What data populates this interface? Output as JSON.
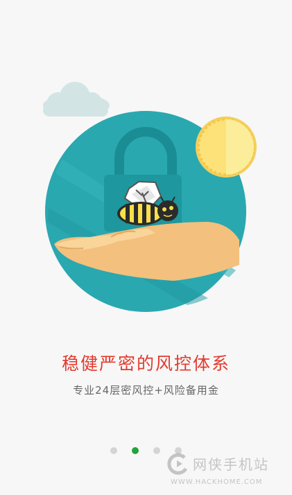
{
  "slide": {
    "headline": "稳健严密的风控体系",
    "subtitle": "专业24层密风控+风险备用金"
  },
  "pager": {
    "total": 4,
    "active_index": 1
  },
  "watermark": {
    "name": "网侠手机站",
    "url": "WWW.HACKHOME.COM"
  },
  "colors": {
    "headline": "#e23a2e",
    "active_dot": "#22a43a",
    "inactive_dot": "#d4d4d4",
    "circle_teal": "#2aa8b0",
    "sun": "#fde27a"
  },
  "icons": [
    "cloud-icon",
    "sun-icon",
    "padlock-icon",
    "bee-icon",
    "hand-icon"
  ]
}
